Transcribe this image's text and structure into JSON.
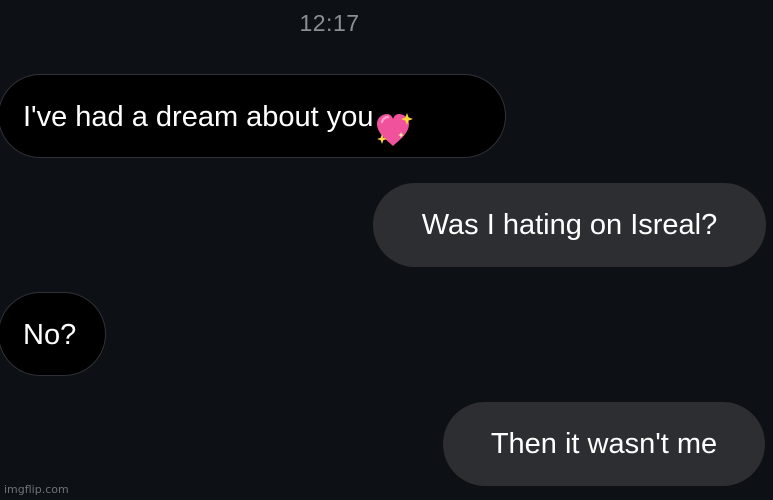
{
  "conversation": {
    "timestamp": "12:17",
    "messages": [
      {
        "direction": "received",
        "text": "I've had a dream about you",
        "emoji": "sparkling-heart-icon"
      },
      {
        "direction": "sent",
        "text": "Was I hating on Isreal?"
      },
      {
        "direction": "received",
        "text": "No?"
      },
      {
        "direction": "sent",
        "text": "Then it wasn't me"
      }
    ]
  },
  "colors": {
    "background": "#0d1014",
    "received_bubble": "#000000",
    "received_border": "#2e3236",
    "sent_bubble": "#2d2e32",
    "timestamp_text": "#8c8f94",
    "heart": "#f0529c",
    "sparkle": "#ffd43b"
  },
  "watermark": "imgflip.com"
}
